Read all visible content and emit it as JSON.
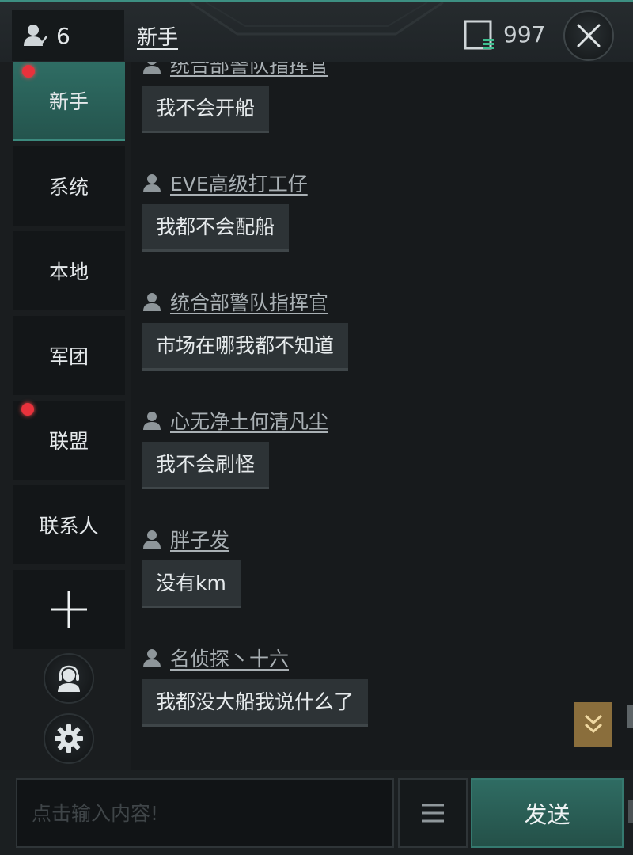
{
  "header": {
    "online_count": "6",
    "channel_title": "新手",
    "credit_value": "997"
  },
  "sidebar": {
    "tabs": [
      {
        "label": "新手",
        "active": true,
        "badge": true
      },
      {
        "label": "系统",
        "active": false,
        "badge": false
      },
      {
        "label": "本地",
        "active": false,
        "badge": false
      },
      {
        "label": "军团",
        "active": false,
        "badge": false
      },
      {
        "label": "联盟",
        "active": false,
        "badge": true
      },
      {
        "label": "联系人",
        "active": false,
        "badge": false
      }
    ],
    "icons": {
      "add": "plus-icon",
      "support": "headset-icon",
      "settings": "gear-icon"
    }
  },
  "messages": [
    {
      "sender": "统合部警队指挥官",
      "text": "我不会开船"
    },
    {
      "sender": "EVE高级打工仔",
      "text": "我都不会配船"
    },
    {
      "sender": "统合部警队指挥官",
      "text": "市场在哪我都不知道"
    },
    {
      "sender": "心无净土何清凡尘",
      "text": "我不会刷怪"
    },
    {
      "sender": "胖子发",
      "text": "没有km"
    },
    {
      "sender": "名侦探丶十六",
      "text": "我都没大船我说什么了"
    }
  ],
  "input": {
    "placeholder": "点击输入内容!",
    "value": "",
    "send_label": "发送"
  },
  "colors": {
    "accent": "#2f6d64",
    "badge": "#e8323c",
    "scroll_button": "#8a6e3c"
  }
}
